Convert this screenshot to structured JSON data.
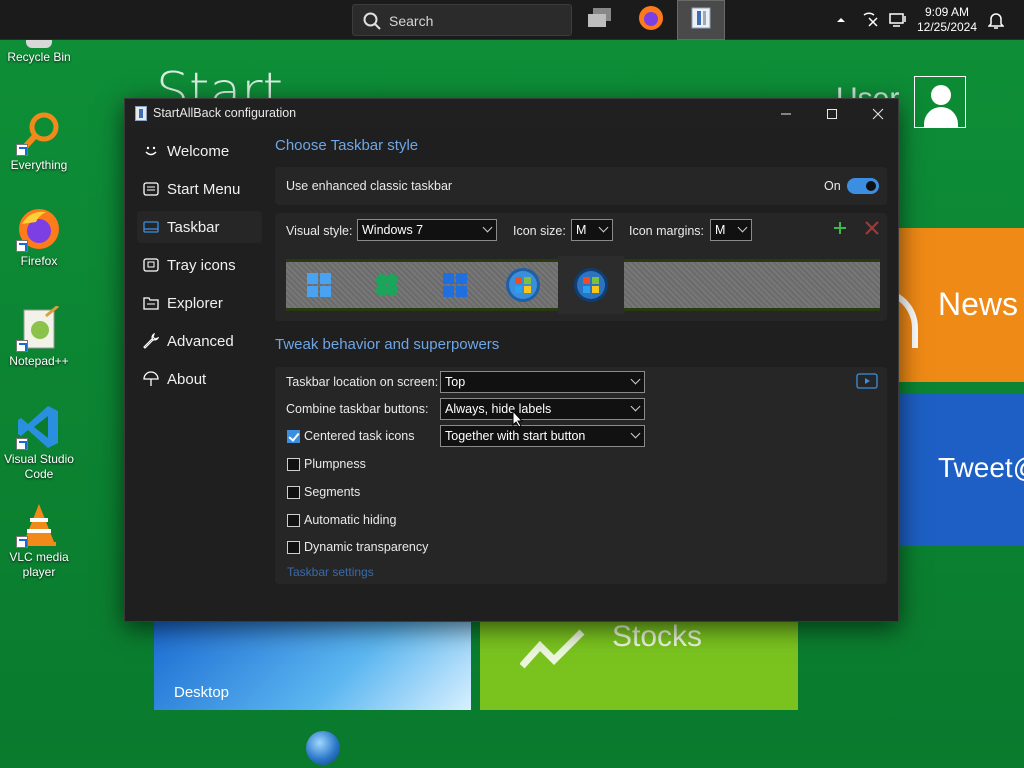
{
  "background": {
    "start_text": "Start",
    "user_text": "User",
    "tiles": {
      "news": "News",
      "tweet": "Tweet@",
      "desktop": "Desktop",
      "stocks": "Stocks"
    }
  },
  "taskbar": {
    "search_placeholder": "Search",
    "time": "9:09 AM",
    "date": "12/25/2024"
  },
  "desktop_icons": [
    {
      "label": "Recycle Bin",
      "icon": "recycle-bin-icon"
    },
    {
      "label": "Everything",
      "icon": "everything-search-icon"
    },
    {
      "label": "Firefox",
      "icon": "firefox-icon"
    },
    {
      "label": "Notepad++",
      "icon": "notepad-plus-plus-icon"
    },
    {
      "label": "Visual Studio Code",
      "icon": "vscode-icon"
    },
    {
      "label": "VLC media player",
      "icon": "vlc-icon"
    }
  ],
  "window": {
    "title": "StartAllBack configuration",
    "nav": [
      {
        "label": "Welcome",
        "icon": "smiley-icon"
      },
      {
        "label": "Start Menu",
        "icon": "start-menu-icon"
      },
      {
        "label": "Taskbar",
        "icon": "taskbar-icon"
      },
      {
        "label": "Tray icons",
        "icon": "tray-icon"
      },
      {
        "label": "Explorer",
        "icon": "folder-icon"
      },
      {
        "label": "Advanced",
        "icon": "wrench-icon"
      },
      {
        "label": "About",
        "icon": "umbrella-icon"
      }
    ],
    "active_nav": "Taskbar",
    "taskbar_style": {
      "heading": "Choose Taskbar style",
      "enhanced_label": "Use enhanced classic taskbar",
      "enhanced_state": "On",
      "visual_style_label": "Visual style:",
      "visual_style_value": "Windows 7",
      "icon_size_label": "Icon size:",
      "icon_size_value": "M",
      "icon_margins_label": "Icon margins:",
      "icon_margins_value": "M"
    },
    "tweaks": {
      "heading": "Tweak behavior and superpowers",
      "location_label": "Taskbar location on screen:",
      "location_value": "Top",
      "combine_label": "Combine taskbar buttons:",
      "combine_value": "Always, hide labels",
      "centered_label": "Centered task icons",
      "centered_value": "Together with start button",
      "centered_checked": true,
      "plumpness_label": "Plumpness",
      "segments_label": "Segments",
      "autohide_label": "Automatic hiding",
      "dyntrans_label": "Dynamic transparency",
      "settings_link": "Taskbar settings"
    }
  },
  "colors": {
    "accent": "#3b8ee0",
    "heading_blue": "#6ea6e6",
    "desktop_green": "#0d8a33"
  }
}
